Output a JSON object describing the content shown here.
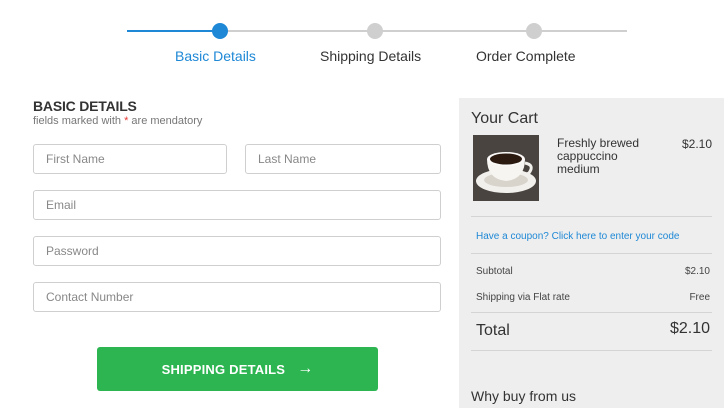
{
  "stepper": {
    "steps": [
      {
        "label": "Basic Details",
        "state": "active"
      },
      {
        "label": "Shipping Details",
        "state": "inactive"
      },
      {
        "label": "Order Complete",
        "state": "inactive"
      }
    ],
    "active_color": "#1e88d6",
    "inactive_color": "#cfcfcf"
  },
  "form": {
    "title": "BASIC DETAILS",
    "subtitle_pre": "fields marked with ",
    "required_mark": "*",
    "subtitle_post": " are mendatory",
    "fields": {
      "first_name": {
        "placeholder": "First Name",
        "value": ""
      },
      "last_name": {
        "placeholder": "Last Name",
        "value": ""
      },
      "email": {
        "placeholder": "Email",
        "value": ""
      },
      "password": {
        "placeholder": "Password",
        "value": ""
      },
      "contact": {
        "placeholder": "Contact Number",
        "value": ""
      }
    },
    "submit_label": "SHIPPING DETAILS",
    "submit_icon": "arrow-right-icon",
    "submit_color": "#2db552"
  },
  "cart": {
    "title": "Your Cart",
    "item": {
      "name": "Freshly brewed cappuccino medium",
      "price": "$2.10",
      "image": "coffee-cup-image"
    },
    "coupon_text": "Have a coupon? Click here to enter your code",
    "subtotal_label": "Subtotal",
    "subtotal_value": "$2.10",
    "shipping_label": "Shipping via Flat rate",
    "shipping_value": "Free",
    "total_label": "Total",
    "total_value": "$2.10",
    "why_title": "Why buy from us"
  }
}
